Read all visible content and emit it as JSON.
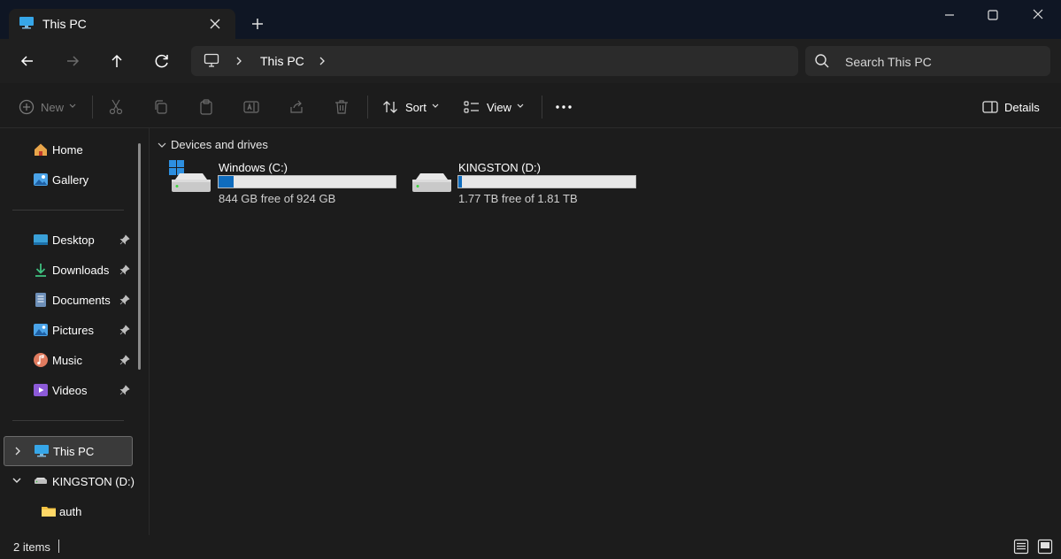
{
  "tab": {
    "title": "This PC"
  },
  "address": {
    "crumb": "This PC"
  },
  "search": {
    "placeholder": "Search This PC"
  },
  "toolbar": {
    "new_label": "New",
    "sort_label": "Sort",
    "view_label": "View",
    "details_label": "Details"
  },
  "sidebar": {
    "items": [
      {
        "label": "Home",
        "icon": "home-icon"
      },
      {
        "label": "Gallery",
        "icon": "gallery-icon"
      },
      {
        "label": "Desktop",
        "icon": "desktop-icon",
        "pinned": true
      },
      {
        "label": "Downloads",
        "icon": "download-icon",
        "pinned": true
      },
      {
        "label": "Documents",
        "icon": "documents-icon",
        "pinned": true
      },
      {
        "label": "Pictures",
        "icon": "pictures-icon",
        "pinned": true
      },
      {
        "label": "Music",
        "icon": "music-icon",
        "pinned": true
      },
      {
        "label": "Videos",
        "icon": "videos-icon",
        "pinned": true
      },
      {
        "label": "This PC",
        "icon": "computer-icon",
        "selected": true
      },
      {
        "label": "KINGSTON (D:)",
        "icon": "drive-icon",
        "expanded": true
      },
      {
        "label": "auth",
        "icon": "folder-icon"
      }
    ]
  },
  "content": {
    "group_header": "Devices and drives",
    "drives": [
      {
        "name": "Windows (C:)",
        "free_text": "844 GB free of 924 GB",
        "used_fraction": 0.087
      },
      {
        "name": "KINGSTON (D:)",
        "free_text": "1.77 TB free of 1.81 TB",
        "used_fraction": 0.022
      }
    ]
  },
  "status": {
    "item_count": "2 items"
  },
  "colors": {
    "accent": "#0f6cbd",
    "background": "#1c1c1c",
    "titlebar": "#0f1624"
  }
}
